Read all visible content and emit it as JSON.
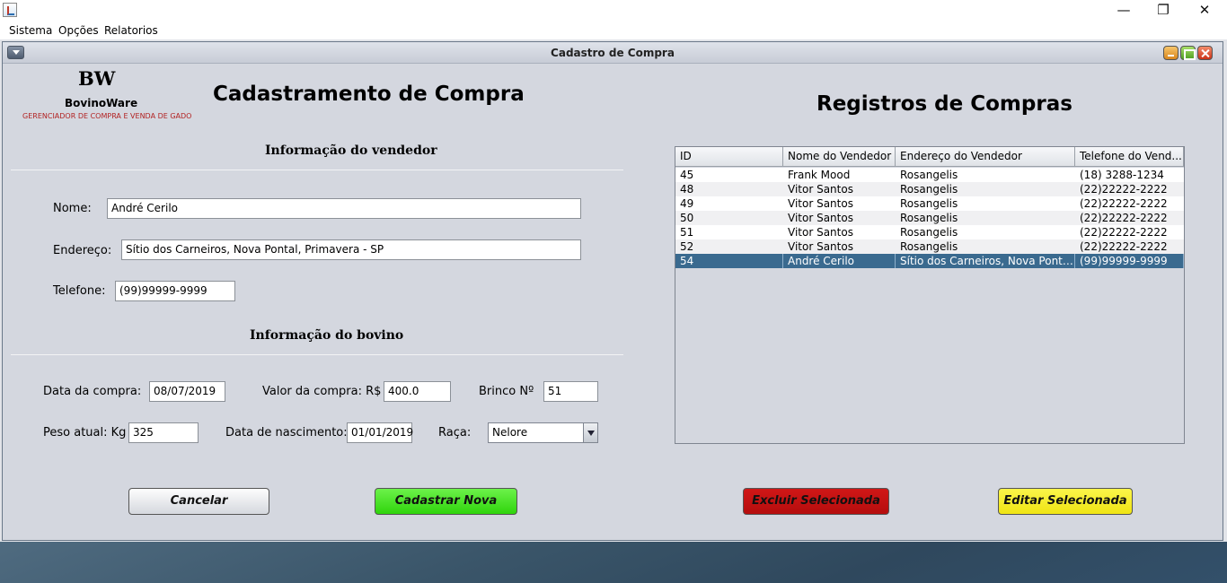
{
  "window": {
    "controls": {
      "minimize": "—",
      "restore": "❐",
      "close": "✕"
    }
  },
  "menubar": {
    "items": [
      "Sistema",
      "Opções",
      "Relatorios"
    ]
  },
  "frame": {
    "title": "Cadastro de Compra"
  },
  "logo": {
    "mark": "BW",
    "name": "BovinoWare",
    "tagline": "GERENCIADOR DE COMPRA E VENDA DE GADO"
  },
  "form": {
    "title": "Cadastramento de Compra",
    "seller_section": "Informação do vendedor",
    "bovine_section": "Informação do bovino",
    "nome": {
      "label": "Nome:",
      "value": "André Cerilo"
    },
    "endereco": {
      "label": "Endereço:",
      "value": "Sítio dos Carneiros, Nova Pontal, Primavera - SP"
    },
    "telefone": {
      "label": "Telefone:",
      "value": "(99)99999-9999"
    },
    "data_compra": {
      "label": "Data da compra:",
      "value": "08/07/2019"
    },
    "valor_compra": {
      "label": "Valor da compra: R$",
      "value": "400.0"
    },
    "brinco": {
      "label": "Brinco Nº",
      "value": "51"
    },
    "peso": {
      "label": "Peso atual: Kg",
      "value": "325"
    },
    "nascimento": {
      "label": "Data de nascimento:",
      "value": "01/01/2019"
    },
    "raca": {
      "label": "Raça:",
      "value": "Nelore"
    }
  },
  "records": {
    "title": "Registros de Compras",
    "columns": [
      "ID",
      "Nome do Vendedor",
      "Endereço do Vendedor",
      "Telefone do Vend..."
    ],
    "rows": [
      [
        "45",
        "Frank Mood",
        "Rosangelis",
        "(18) 3288-1234"
      ],
      [
        "48",
        "Vitor Santos",
        "Rosangelis",
        "(22)22222-2222"
      ],
      [
        "49",
        "Vitor Santos",
        "Rosangelis",
        "(22)22222-2222"
      ],
      [
        "50",
        "Vitor Santos",
        "Rosangelis",
        "(22)22222-2222"
      ],
      [
        "51",
        "Vitor Santos",
        "Rosangelis",
        "(22)22222-2222"
      ],
      [
        "52",
        "Vitor Santos",
        "Rosangelis",
        "(22)22222-2222"
      ],
      [
        "54",
        "André Cerilo",
        "Sítio dos Carneiros, Nova Pontal,...",
        "(99)99999-9999"
      ]
    ],
    "selected_row": 6
  },
  "buttons": {
    "cancel": "Cancelar",
    "new": "Cadastrar Nova",
    "delete": "Excluir Selecionada",
    "edit": "Editar Selecionada"
  },
  "colors": {
    "selection": "#3a6a8f",
    "new_button": "#34d811",
    "delete_button": "#c41212",
    "edit_button": "#f5ea1f"
  },
  "icons": {
    "app": "java-app-icon",
    "frame_menu": "chevron-down-icon",
    "combo": "dropdown-arrow-icon"
  }
}
